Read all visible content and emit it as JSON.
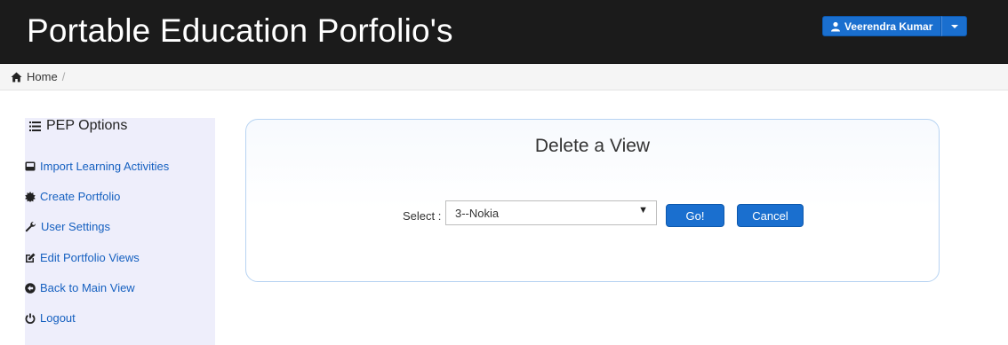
{
  "header": {
    "title": "Portable Education Porfolio's",
    "user_name": "Veerendra Kumar"
  },
  "breadcrumb": {
    "home": "Home",
    "separator": "/"
  },
  "sidebar": {
    "title": "PEP Options",
    "items": [
      {
        "label": "Import Learning Activities",
        "icon": "hdd-icon"
      },
      {
        "label": "Create Portfolio",
        "icon": "certificate-icon"
      },
      {
        "label": "User Settings",
        "icon": "wrench-icon"
      },
      {
        "label": "Edit Portfolio Views",
        "icon": "edit-icon"
      },
      {
        "label": "Back to Main View",
        "icon": "circle-arrow-left-icon"
      },
      {
        "label": "Logout",
        "icon": "power-icon"
      }
    ]
  },
  "panel": {
    "title": "Delete a View",
    "select_label": "Select :",
    "selected_value": "3--Nokia",
    "go_label": "Go!",
    "cancel_label": "Cancel"
  },
  "colors": {
    "header_bg": "#1b1b1b",
    "primary_button": "#1a6fcf",
    "sidebar_bg": "#eeeefb",
    "link": "#1560c0"
  }
}
